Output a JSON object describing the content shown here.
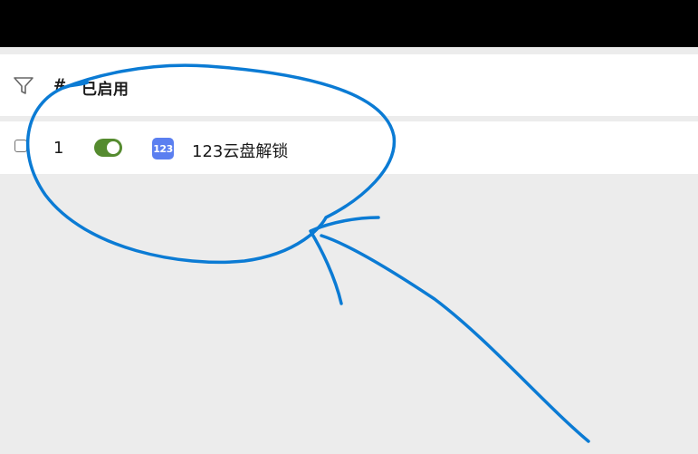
{
  "table": {
    "headers": {
      "index": "#",
      "enabled": "已启用"
    },
    "rows": [
      {
        "index": "1",
        "enabled": true,
        "icon_text": "123",
        "name": "123云盘解锁"
      }
    ]
  },
  "colors": {
    "toggle_on": "#558b2f",
    "app_icon": "#5b7ff0",
    "annotation": "#0b7bd4"
  },
  "icons": {
    "filter": "filter-icon",
    "app": "app-123-icon"
  }
}
